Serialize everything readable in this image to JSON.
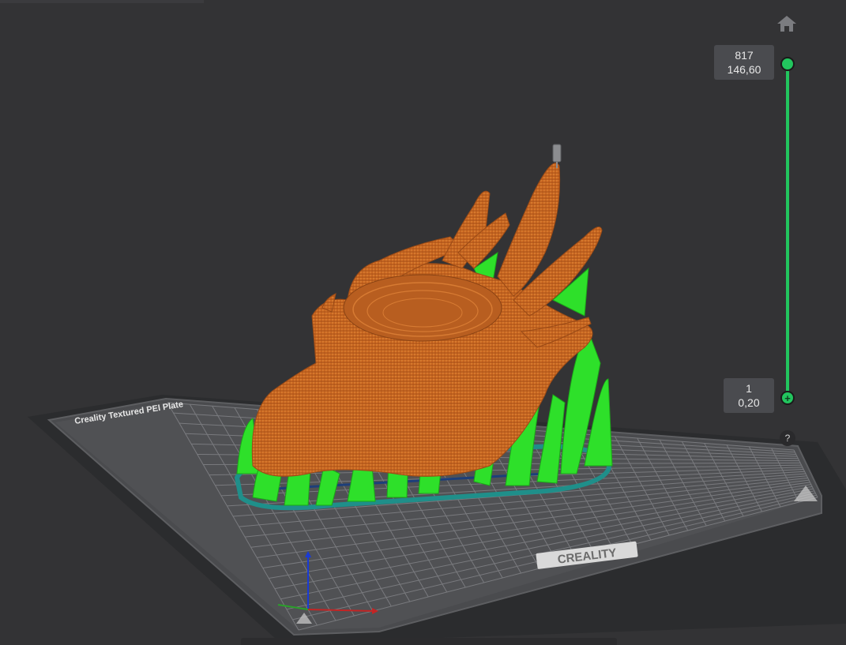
{
  "viewport": {
    "plate_title": "Creality Textured PEI Plate",
    "plate_brand": "CREALITY",
    "colors": {
      "background": "#333335",
      "plate": "#47484b",
      "grid": "#8a8b8e",
      "model": "#d0702a",
      "support": "#2ee02a",
      "brim": "#1f8f8a",
      "slider": "#22c55e"
    }
  },
  "layer_slider": {
    "top": {
      "layer": "817",
      "height": "146,60"
    },
    "bottom": {
      "layer": "1",
      "height": "0,20"
    },
    "help": "?"
  },
  "icons": {
    "home": "home-icon",
    "help": "help-icon",
    "axes": "axes-icon"
  }
}
